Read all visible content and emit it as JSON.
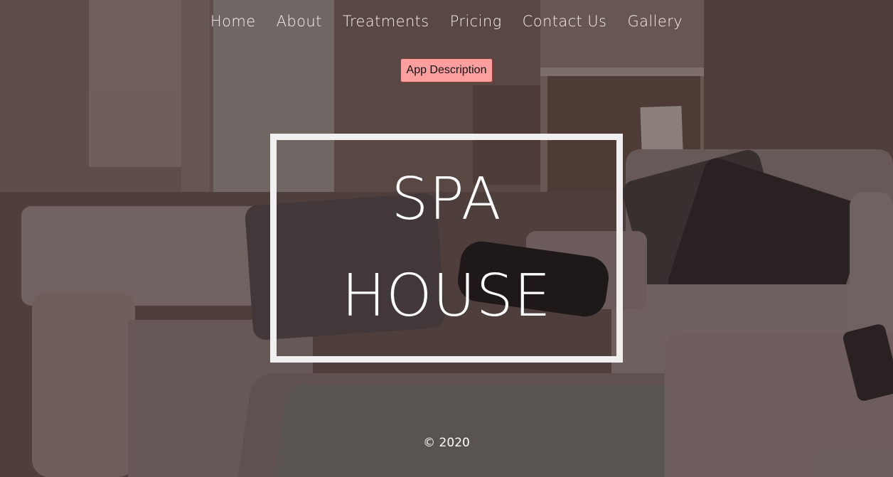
{
  "nav": {
    "items": [
      {
        "label": "Home"
      },
      {
        "label": "About"
      },
      {
        "label": "Treatments"
      },
      {
        "label": "Pricing"
      },
      {
        "label": "Contact Us"
      },
      {
        "label": "Gallery"
      }
    ]
  },
  "app_button": {
    "label": "App Description"
  },
  "hero": {
    "line1": "SPA",
    "line2": "HOUSE"
  },
  "footer": {
    "copyright": "© 2020"
  },
  "colors": {
    "button_bg": "#ff9e9e",
    "text": "#ffffff",
    "frame": "#f1eff0"
  }
}
